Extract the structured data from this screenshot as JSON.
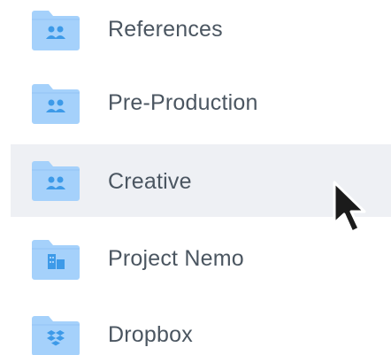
{
  "colors": {
    "folder_fill": "#a5d1fb",
    "folder_glyph": "#3d9ae8",
    "hover_bg": "#eef0f4",
    "label_text": "#4b5661"
  },
  "folders": [
    {
      "label": "References",
      "icon": "shared-folder-icon",
      "hovered": false
    },
    {
      "label": "Pre-Production",
      "icon": "shared-folder-icon",
      "hovered": false
    },
    {
      "label": "Creative",
      "icon": "shared-folder-icon",
      "hovered": true
    },
    {
      "label": "Project Nemo",
      "icon": "team-folder-icon",
      "hovered": false
    },
    {
      "label": "Dropbox",
      "icon": "dropbox-folder-icon",
      "hovered": false
    }
  ],
  "cursor": {
    "icon": "mouse-pointer-icon"
  }
}
